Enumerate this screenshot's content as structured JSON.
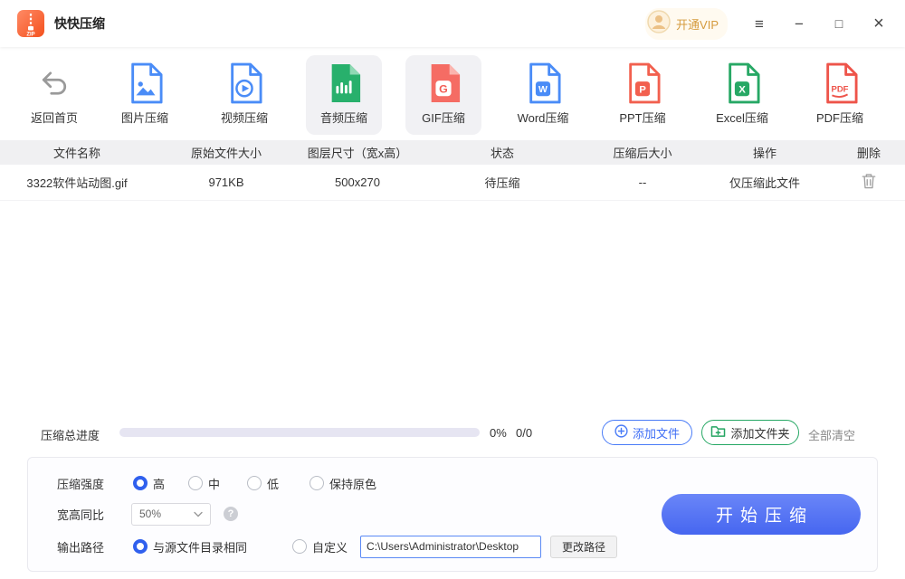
{
  "titlebar": {
    "app_name": "快快压缩",
    "vip_label": "开通VIP",
    "controls": {
      "menu": "≡",
      "minimize": "−",
      "maximize": "□",
      "close": "×"
    },
    "icons": [
      "app-logo-icon",
      "avatar-icon"
    ]
  },
  "toolbar": {
    "items": [
      {
        "label": "返回首页",
        "icon": "back-icon",
        "selected": false
      },
      {
        "label": "图片压缩",
        "icon": "image-doc-icon",
        "selected": false
      },
      {
        "label": "视频压缩",
        "icon": "video-doc-icon",
        "selected": false
      },
      {
        "label": "音频压缩",
        "icon": "audio-doc-icon",
        "selected": true
      },
      {
        "label": "GIF压缩",
        "icon": "gif-doc-icon",
        "selected": true
      },
      {
        "label": "Word压缩",
        "icon": "word-doc-icon",
        "selected": false
      },
      {
        "label": "PPT压缩",
        "icon": "ppt-doc-icon",
        "selected": false
      },
      {
        "label": "Excel压缩",
        "icon": "excel-doc-icon",
        "selected": false
      },
      {
        "label": "PDF压缩",
        "icon": "pdf-doc-icon",
        "selected": false
      }
    ]
  },
  "table": {
    "headers": [
      "文件名称",
      "原始文件大小",
      "图层尺寸（宽x高）",
      "状态",
      "压缩后大小",
      "操作",
      "删除"
    ],
    "rows": [
      {
        "name": "3322软件站动图.gif",
        "size": "971KB",
        "dimensions": "500x270",
        "status": "待压缩",
        "compressed": "--",
        "action": "仅压缩此文件"
      }
    ]
  },
  "progress": {
    "label": "压缩总进度",
    "percent": "0%",
    "count": "0/0",
    "add_file_label": "添加文件",
    "add_folder_label": "添加文件夹",
    "clear_all_label": "全部清空"
  },
  "settings": {
    "strength_label": "压缩强度",
    "strength_options": [
      "高",
      "中",
      "低",
      "保持原色"
    ],
    "strength_selected": "高",
    "ratio_label": "宽高同比",
    "ratio_value": "50%",
    "help_glyph": "?",
    "output_label": "输出路径",
    "output_same_label": "与源文件目录相同",
    "output_custom_label": "自定义",
    "output_path": "C:\\Users\\Administrator\\Desktop",
    "change_path_label": "更改路径",
    "start_label": "开始压缩"
  },
  "colors": {
    "accent_blue": "#3d6df5",
    "doc_blue": "#4a8cf7",
    "green": "#27a865",
    "coral": "#f56c64",
    "ppt_orange": "#f2604f",
    "pdf_red": "#ee544a",
    "vip_orange": "#d59b3e"
  }
}
